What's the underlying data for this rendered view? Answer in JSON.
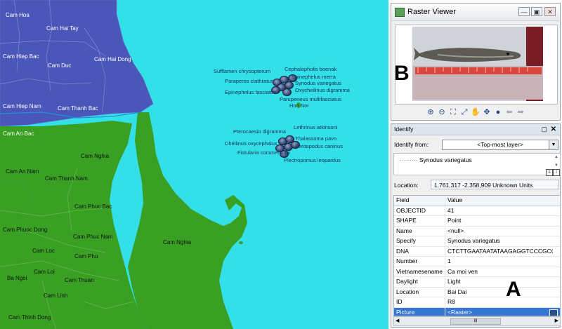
{
  "map": {
    "places": [
      {
        "name": "Cam Hoa",
        "color": "w"
      },
      {
        "name": "Cam Hai Tay",
        "color": "w"
      },
      {
        "name": "Cam Hiep Bac",
        "color": "w"
      },
      {
        "name": "Cam Duc",
        "color": "w"
      },
      {
        "name": "Cam Hai Dong",
        "color": "w"
      },
      {
        "name": "Cam Hiep Nam",
        "color": "w"
      },
      {
        "name": "Cam Thanh Bac",
        "color": "w"
      },
      {
        "name": "Cam An Bac",
        "color": "w"
      },
      {
        "name": "Cam Nghia",
        "color": "d"
      },
      {
        "name": "Cam An Nam",
        "color": "d"
      },
      {
        "name": "Cam Thanh Nam",
        "color": "d"
      },
      {
        "name": "Cam Phuc Bac",
        "color": "d"
      },
      {
        "name": "Cam Phuoc Dong",
        "color": "d"
      },
      {
        "name": "Cam Phuc Nam",
        "color": "d"
      },
      {
        "name": "Cam Loc",
        "color": "d"
      },
      {
        "name": "Cam Phu",
        "color": "d"
      },
      {
        "name": "Cam Nghia",
        "color": "d"
      },
      {
        "name": "Cam Loi",
        "color": "d"
      },
      {
        "name": "Ba Ngoi",
        "color": "d"
      },
      {
        "name": "Cam Thuan",
        "color": "d"
      },
      {
        "name": "Cam Linh",
        "color": "d"
      },
      {
        "name": "Cam Thinh Dong",
        "color": "d"
      }
    ],
    "species": [
      "Sufflamen chrysopterum",
      "Cephalopholis boenak",
      "Paraperos clathratus",
      "Epinephelus merra",
      "Synodus variegatus",
      "Epinephelus fasciatus",
      "Oxycheilinus digramma",
      "Parupeneus multifasciatus",
      "Hon Noi",
      "Lethrinus atkinsoni",
      "Pterocaesio digramma",
      "Thalassoma pavo",
      "Cheilinus oxycephalus",
      "Pentapodus caninus",
      "Fistularia commersonii",
      "Plectropomus leopardus"
    ],
    "colors": {
      "sea": "#33e0e8",
      "north": "#4a57b8",
      "south": "#39a024"
    }
  },
  "annotations": {
    "a": "A",
    "b": "B"
  },
  "raster_viewer": {
    "title": "Raster Viewer",
    "minimize": "—",
    "maximize": "▣",
    "close": "✕",
    "tools": [
      "zoom-in",
      "zoom-out",
      "fit",
      "full-extent",
      "pan",
      "zoom-window",
      "globe",
      "back",
      "forward"
    ]
  },
  "identify": {
    "title": "Identify",
    "from_label": "Identify from:",
    "from_value": "<Top-most layer>",
    "tree_item": "Synodus variegatus",
    "location_label": "Location:",
    "location_value": "1.761,317  -2.358,909 Unknown Units",
    "columns": {
      "field": "Field",
      "value": "Value"
    },
    "rows": [
      {
        "field": "OBJECTID",
        "value": "41"
      },
      {
        "field": "SHAPE",
        "value": "Point"
      },
      {
        "field": "Name",
        "value": "<null>"
      },
      {
        "field": "Specify",
        "value": "Synodus variegatus"
      },
      {
        "field": "DNA",
        "value": "CTCTTGAATAATATAAGAGGTCCCGCCTGC"
      },
      {
        "field": "Number",
        "value": "1"
      },
      {
        "field": "Vietnamesename",
        "value": "Ca moi ven"
      },
      {
        "field": "Daylight",
        "value": "Light"
      },
      {
        "field": "Location",
        "value": "Bai Dai"
      },
      {
        "field": "ID",
        "value": "R8"
      },
      {
        "field": "Picture",
        "value": "<Raster>"
      }
    ],
    "scroll_grip": "III"
  }
}
